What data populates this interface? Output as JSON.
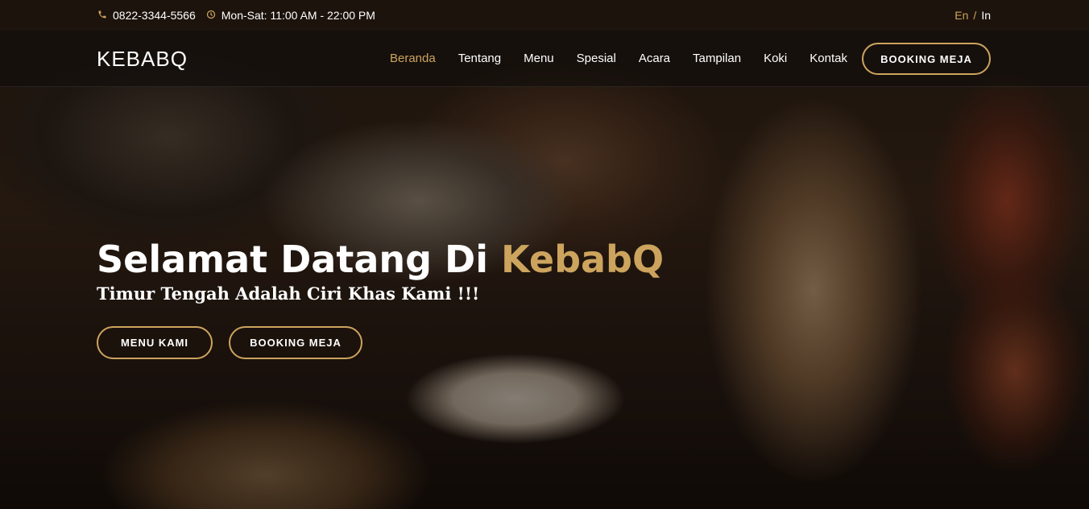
{
  "topbar": {
    "phone_icon": "phone-icon",
    "phone": "0822-3344-5566",
    "clock_icon": "clock-icon",
    "hours": "Mon-Sat: 11:00 AM - 22:00 PM",
    "lang_en": "En",
    "lang_sep": "/",
    "lang_in": "In"
  },
  "navbar": {
    "logo": "KEBABQ",
    "links": [
      {
        "label": "Beranda",
        "active": true
      },
      {
        "label": "Tentang"
      },
      {
        "label": "Menu"
      },
      {
        "label": "Spesial"
      },
      {
        "label": "Acara"
      },
      {
        "label": "Tampilan"
      },
      {
        "label": "Koki"
      },
      {
        "label": "Kontak"
      }
    ],
    "booking_label": "BOOKING MEJA"
  },
  "hero": {
    "title_prefix": "Selamat Datang Di ",
    "title_brand": "KebabQ",
    "subtitle": "Timur Tengah Adalah Ciri Khas Kami !!!",
    "btn_menu": "MENU KAMI",
    "btn_booking": "BOOKING MEJA"
  },
  "colors": {
    "accent": "#cda45e",
    "navbar_bg": "rgba(20,15,12,0.72)"
  }
}
